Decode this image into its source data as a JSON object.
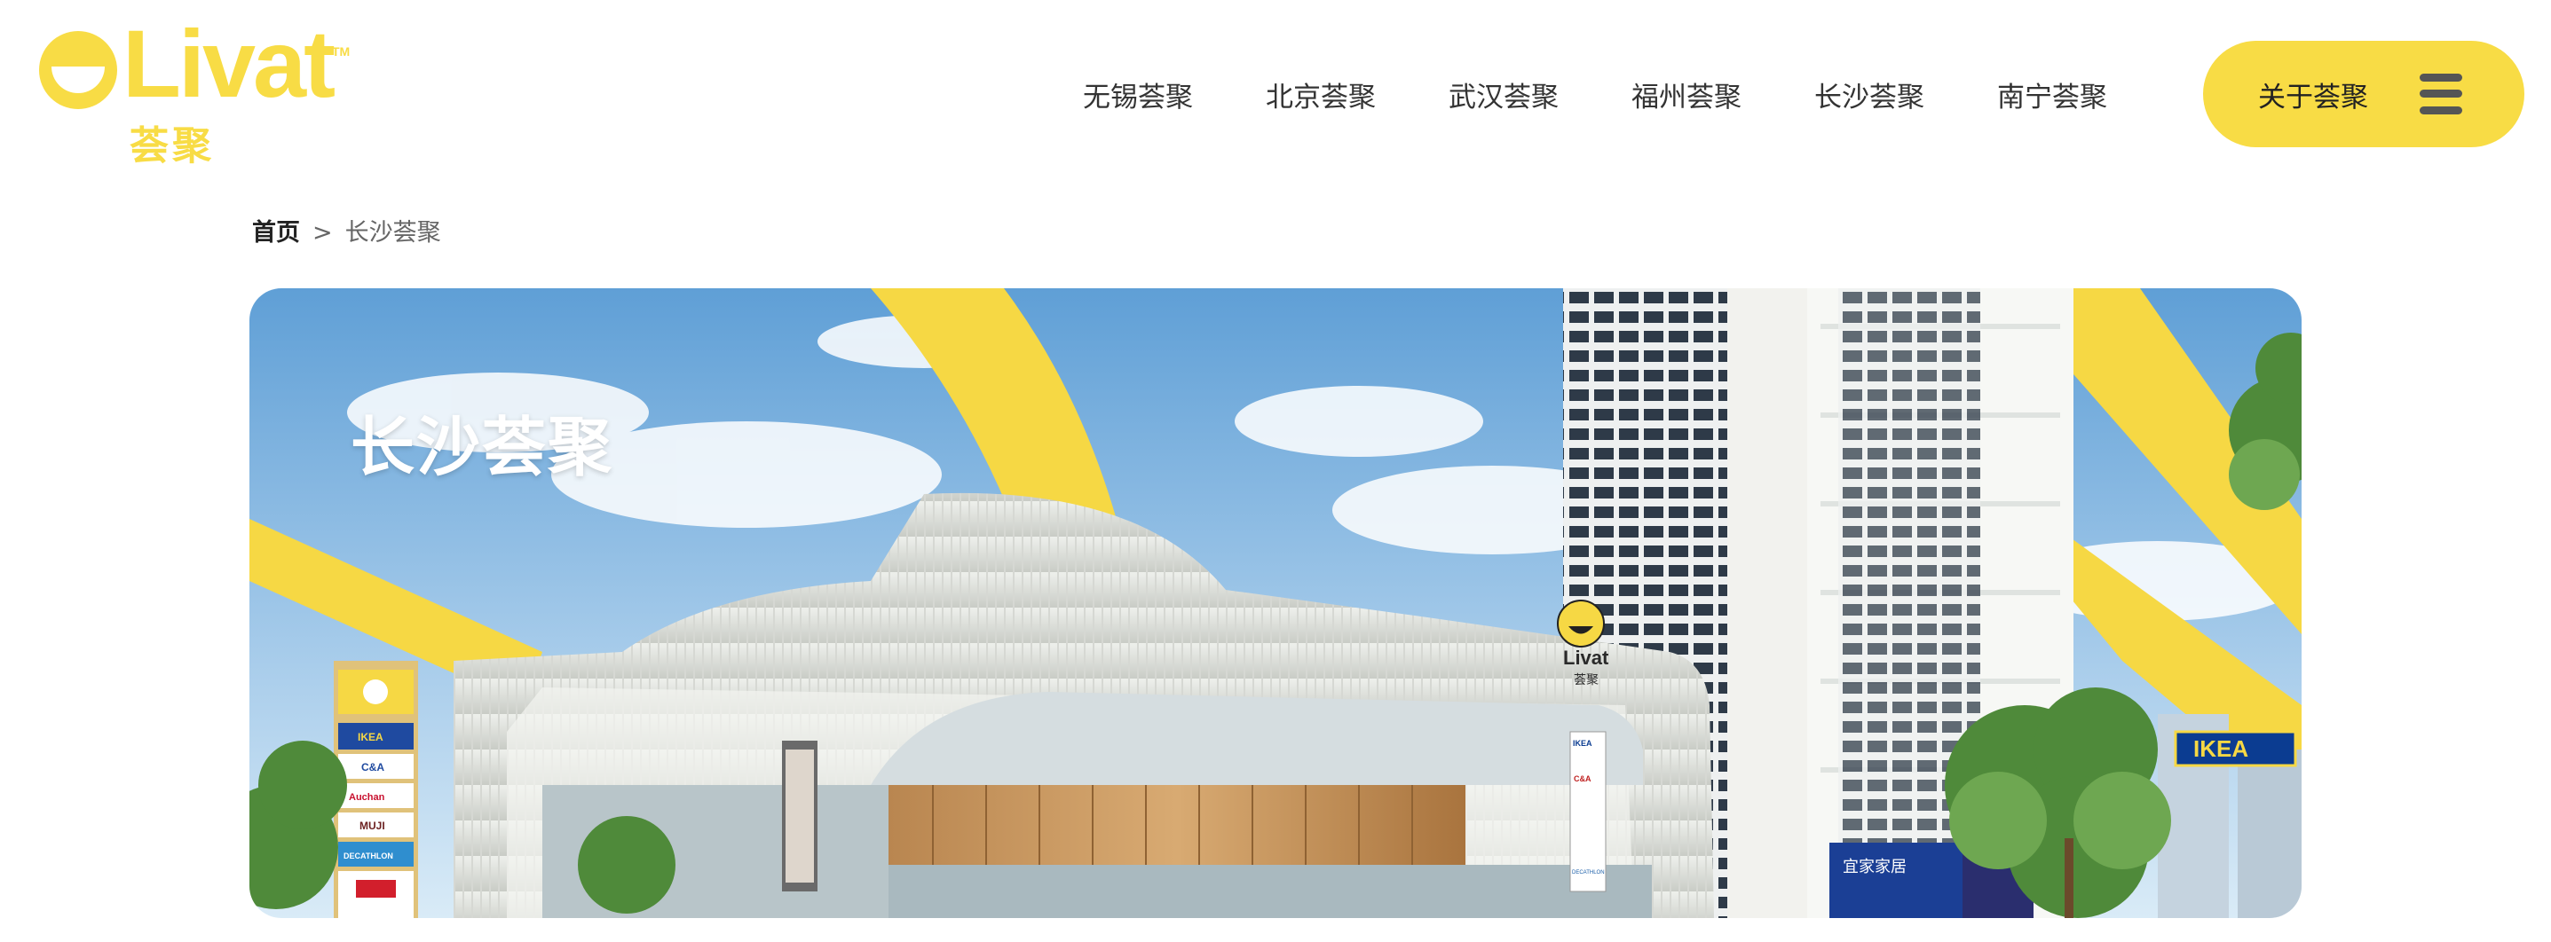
{
  "brand": {
    "wordmark": "Livat",
    "trademark": "TM",
    "chinese_name": "荟聚",
    "accent_color": "#f8dc45"
  },
  "nav": {
    "items": [
      {
        "label": "无锡荟聚"
      },
      {
        "label": "北京荟聚"
      },
      {
        "label": "武汉荟聚"
      },
      {
        "label": "福州荟聚"
      },
      {
        "label": "长沙荟聚"
      },
      {
        "label": "南宁荟聚"
      }
    ],
    "about_label": "关于荟聚",
    "menu_icon": "hamburger-menu-icon"
  },
  "breadcrumb": {
    "home": "首页",
    "separator": ">",
    "current": "长沙荟聚"
  },
  "hero": {
    "title": "长沙荟聚",
    "pylon_brands": [
      "IKEA",
      "C&A",
      "Auchan",
      "MUJI",
      "DECATHLON"
    ],
    "mall_sign_word": "Livat",
    "mall_sign_cn": "荟聚",
    "facade_brands": [
      "IKEA",
      "C&A",
      "DECATHLON"
    ],
    "ikea_sign": "IKEA",
    "ikea_cn_sign": "宜家家居"
  }
}
